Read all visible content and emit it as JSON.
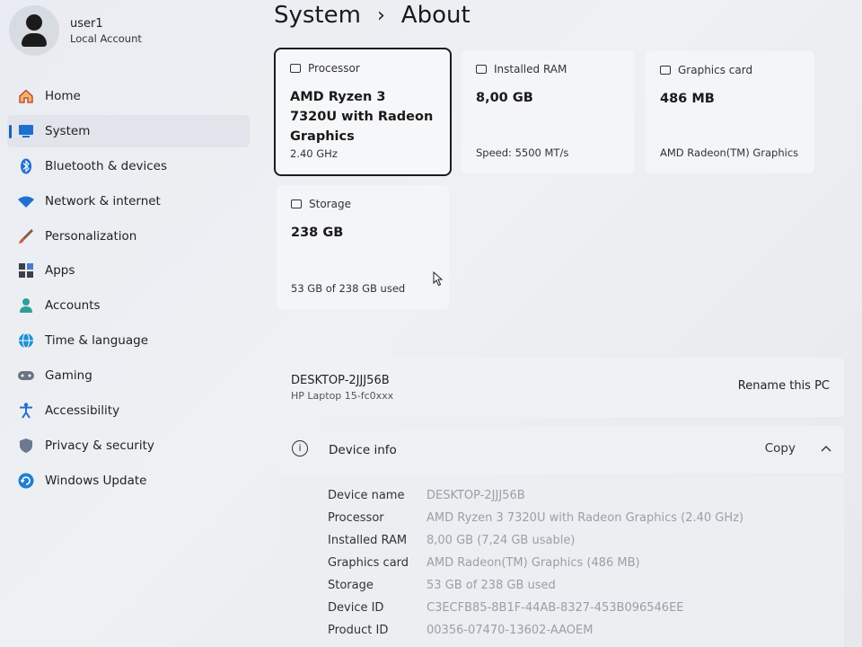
{
  "profile": {
    "name": "user1",
    "account_type": "Local Account"
  },
  "nav": [
    {
      "label": "Home",
      "icon": "home-icon",
      "active": false
    },
    {
      "label": "System",
      "icon": "system-icon",
      "active": true
    },
    {
      "label": "Bluetooth & devices",
      "icon": "bluetooth-icon",
      "active": false
    },
    {
      "label": "Network & internet",
      "icon": "wifi-icon",
      "active": false
    },
    {
      "label": "Personalization",
      "icon": "brush-icon",
      "active": false
    },
    {
      "label": "Apps",
      "icon": "apps-icon",
      "active": false
    },
    {
      "label": "Accounts",
      "icon": "person-icon",
      "active": false
    },
    {
      "label": "Time & language",
      "icon": "globe-icon",
      "active": false
    },
    {
      "label": "Gaming",
      "icon": "gamepad-icon",
      "active": false
    },
    {
      "label": "Accessibility",
      "icon": "accessibility-icon",
      "active": false
    },
    {
      "label": "Privacy & security",
      "icon": "shield-icon",
      "active": false
    },
    {
      "label": "Windows Update",
      "icon": "update-icon",
      "active": false
    }
  ],
  "header": {
    "parent": "System",
    "separator": "›",
    "current": "About"
  },
  "cards": {
    "processor": {
      "title": "Processor",
      "value": "AMD Ryzen 3 7320U with Radeon Graphics",
      "sub": "2.40 GHz"
    },
    "ram": {
      "title": "Installed RAM",
      "value": "8,00 GB",
      "sub": "Speed: 5500 MT/s"
    },
    "graphics": {
      "title": "Graphics card",
      "value": "486 MB",
      "sub": "AMD Radeon(TM) Graphics"
    },
    "storage": {
      "title": "Storage",
      "value": "238 GB",
      "sub": "53 GB of 238 GB used"
    }
  },
  "pc": {
    "name": "DESKTOP-2JJJ56B",
    "model": "HP Laptop 15-fc0xxx",
    "rename_label": "Rename this PC"
  },
  "device_info": {
    "title": "Device info",
    "copy_label": "Copy",
    "specs": [
      {
        "key": "Device name",
        "value": "DESKTOP-2JJJ56B"
      },
      {
        "key": "Processor",
        "value": "AMD Ryzen 3 7320U with Radeon Graphics (2.40 GHz)"
      },
      {
        "key": "Installed RAM",
        "value": "8,00 GB (7,24 GB usable)"
      },
      {
        "key": "Graphics card",
        "value": "AMD Radeon(TM) Graphics (486 MB)"
      },
      {
        "key": "Storage",
        "value": "53 GB of 238 GB used"
      },
      {
        "key": "Device ID",
        "value": "C3ECFB85-8B1F-44AB-8327-453B096546EE"
      },
      {
        "key": "Product ID",
        "value": "00356-07470-13602-AAOEM"
      }
    ]
  },
  "colors": {
    "accent": "#1c5fbf"
  }
}
